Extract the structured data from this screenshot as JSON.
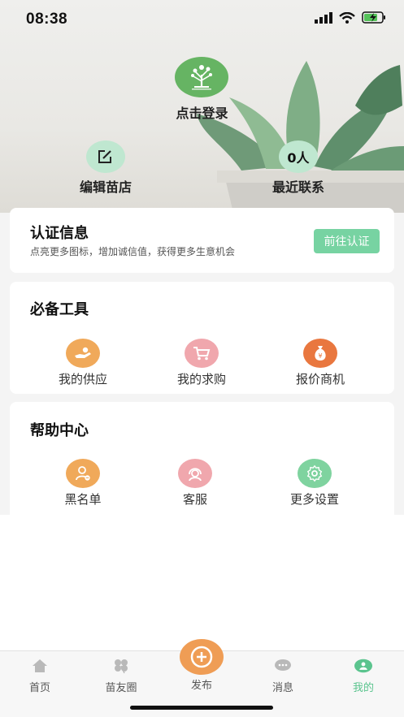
{
  "status_bar": {
    "time": "08:38"
  },
  "hero": {
    "login_text": "点击登录",
    "edit_shop_label": "编辑苗店",
    "recent_contacts_count": "0人",
    "recent_contacts_label": "最近联系"
  },
  "certification": {
    "title": "认证信息",
    "description": "点亮更多图标，增加诚信值，获得更多生意机会",
    "button": "前往认证"
  },
  "tools": {
    "title": "必备工具",
    "items": [
      {
        "label": "我的供应",
        "icon": "supply-hand-icon",
        "color": "#f0a95a"
      },
      {
        "label": "我的求购",
        "icon": "cart-icon",
        "color": "#f0a7ad"
      },
      {
        "label": "报价商机",
        "icon": "money-bag-icon",
        "color": "#e9773f"
      }
    ]
  },
  "help": {
    "title": "帮助中心",
    "items": [
      {
        "label": "黑名单",
        "icon": "blacklist-user-icon",
        "color": "#f0a95a"
      },
      {
        "label": "客服",
        "icon": "customer-service-icon",
        "color": "#f0a7ad"
      },
      {
        "label": "更多设置",
        "icon": "settings-gear-icon",
        "color": "#7fd39f"
      }
    ]
  },
  "tab_bar": {
    "items": [
      {
        "label": "首页",
        "icon": "home-icon"
      },
      {
        "label": "苗友圈",
        "icon": "clover-icon"
      },
      {
        "label": "发布",
        "icon": "plus-circle-icon"
      },
      {
        "label": "消息",
        "icon": "message-bubble-icon"
      },
      {
        "label": "我的",
        "icon": "profile-icon",
        "active": true
      }
    ],
    "active_color": "#5bc48e",
    "publish_color": "#ef9d55"
  }
}
